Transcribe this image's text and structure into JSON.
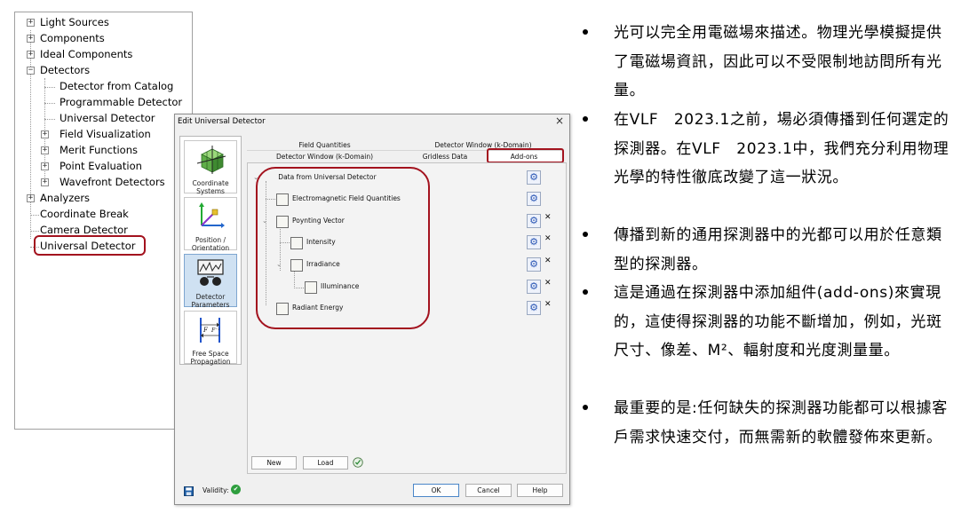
{
  "tree": {
    "items": [
      {
        "label": "Light Sources",
        "expander": "+"
      },
      {
        "label": "Components",
        "expander": "+"
      },
      {
        "label": "Ideal Components",
        "expander": "+"
      },
      {
        "label": "Detectors",
        "expander": "−"
      },
      {
        "label": "Detector from Catalog",
        "expander": ""
      },
      {
        "label": "Programmable Detector",
        "expander": ""
      },
      {
        "label": "Universal Detector",
        "expander": ""
      },
      {
        "label": "Field Visualization",
        "expander": "+"
      },
      {
        "label": "Merit Functions",
        "expander": "+"
      },
      {
        "label": "Point Evaluation",
        "expander": "+"
      },
      {
        "label": "Wavefront Detectors",
        "expander": "+"
      },
      {
        "label": "Analyzers",
        "expander": "+"
      },
      {
        "label": "Coordinate Break",
        "expander": ""
      },
      {
        "label": "Camera Detector",
        "expander": ""
      },
      {
        "label": "Universal Detector",
        "expander": ""
      }
    ],
    "highlight_color": "#a3121e"
  },
  "dialog": {
    "title": "Edit Universal Detector",
    "close": "×",
    "sidebar": [
      {
        "label": "Coordinate Systems",
        "icon": "coordinate-cube-icon"
      },
      {
        "label": "Position / Orientation",
        "icon": "position-axes-icon"
      },
      {
        "label": "Detector Parameters",
        "icon": "detector-parameters-icon"
      },
      {
        "label": "Free Space Propagation",
        "icon": "free-space-propagation-icon"
      }
    ],
    "tabs_top": [
      "Field Quantities",
      "Detector Window (k-Domain)"
    ],
    "tabs_bottom": [
      "Detector Window (k-Domain)",
      "Gridless Data",
      "Add-ons"
    ],
    "addon_tree": [
      {
        "label": "Data from Universal Detector",
        "removable": false
      },
      {
        "label": "Electromagnetic Field Quantities",
        "removable": false
      },
      {
        "label": "Poynting Vector",
        "removable": true
      },
      {
        "label": "Intensity",
        "removable": true
      },
      {
        "label": "Irradiance",
        "removable": true
      },
      {
        "label": "Illuminance",
        "removable": true
      },
      {
        "label": "Radiant Energy",
        "removable": true
      }
    ],
    "remove_symbol": "✕",
    "gear_symbol": "⚙",
    "buttons": {
      "new": "New",
      "load": "Load",
      "ok": "OK",
      "cancel": "Cancel",
      "help": "Help"
    },
    "validity_label": "Validity:",
    "validity_symbol": "✔",
    "colors": {
      "selected_tab": "#ffffff",
      "validity": "#2e9e3e",
      "save": "#1f5fa8"
    }
  },
  "bullets": [
    {
      "text": "光可以完全用電磁場來描述。物理光學模擬提供了電磁場資訊，因此可以不受限制地訪問所有光量。"
    },
    {
      "text": "在VLF　2023.1之前，場必須傳播到任何選定的探測器。在VLF　2023.1中，我們充分利用物理光學的特性徹底改變了這一狀況。"
    },
    {
      "text": "傳播到新的通用探測器中的光都可以用於任意類型的探測器。"
    },
    {
      "text": "這是通過在探測器中添加組件(add-ons)來實現的，這使得探測器的功能不斷增加，例如，光斑尺寸、像差、M²、輻射度和光度測量量。"
    },
    {
      "text": "最重要的是:任何缺失的探測器功能都可以根據客戶需求快速交付，而無需新的軟體發佈來更新。"
    }
  ]
}
